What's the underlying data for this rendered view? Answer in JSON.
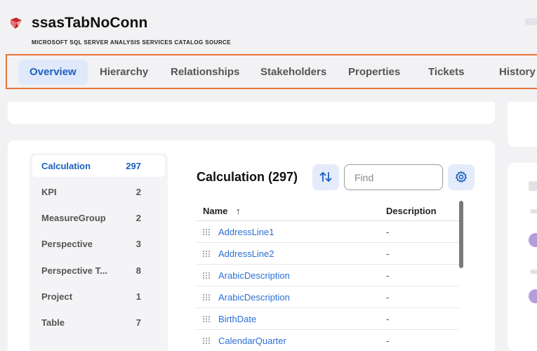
{
  "header": {
    "title": "ssasTabNoConn",
    "subtitle": "MICROSOFT SQL SERVER ANALYSIS SERVICES CATALOG SOURCE",
    "logo_icon": "ssas-cube-logo-icon"
  },
  "tabs": [
    {
      "label": "Overview",
      "active": true
    },
    {
      "label": "Hierarchy",
      "active": false
    },
    {
      "label": "Relationships",
      "active": false
    },
    {
      "label": "Stakeholders",
      "active": false
    },
    {
      "label": "Properties",
      "active": false
    },
    {
      "label": "Tickets",
      "active": false
    },
    {
      "label": "History",
      "active": false
    }
  ],
  "sidebar": {
    "items": [
      {
        "label": "Calculation",
        "count": "297",
        "active": true
      },
      {
        "label": "KPI",
        "count": "2",
        "active": false
      },
      {
        "label": "MeasureGroup",
        "count": "2",
        "active": false
      },
      {
        "label": "Perspective",
        "count": "3",
        "active": false
      },
      {
        "label": "Perspective T...",
        "count": "8",
        "active": false
      },
      {
        "label": "Project",
        "count": "1",
        "active": false
      },
      {
        "label": "Table",
        "count": "7",
        "active": false
      }
    ]
  },
  "content": {
    "title": "Calculation (297)",
    "sort_icon": "sort-arrows-icon",
    "find_placeholder": "Find",
    "gear_icon": "gear-icon",
    "columns": {
      "name": "Name",
      "sort_indicator": "↑",
      "description": "Description"
    },
    "rows": [
      {
        "name": "AddressLine1",
        "description": "-"
      },
      {
        "name": "AddressLine2",
        "description": "-"
      },
      {
        "name": "ArabicDescription",
        "description": "-"
      },
      {
        "name": "ArabicDescription",
        "description": "-"
      },
      {
        "name": "BirthDate",
        "description": "-"
      },
      {
        "name": "CalendarQuarter",
        "description": "-"
      }
    ]
  },
  "colors": {
    "accent": "#1b5fbf",
    "active_tab_bg": "#dfe9fb",
    "highlight_border": "#e8743b",
    "link": "#2a6fd6"
  }
}
